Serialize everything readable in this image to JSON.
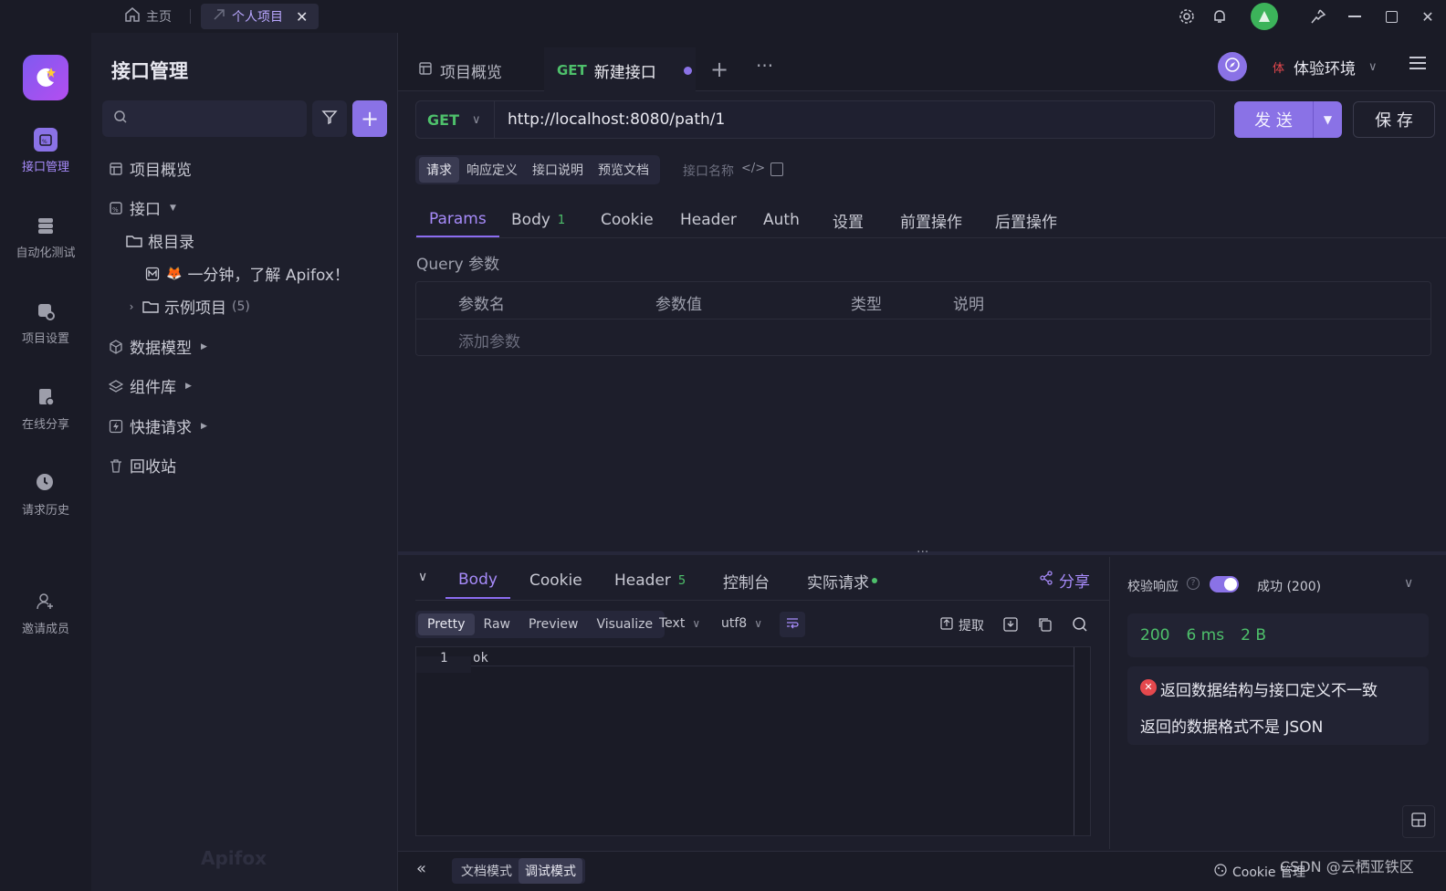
{
  "titlebar": {
    "home_tab": "主页",
    "project_tab": "个人项目"
  },
  "rail": {
    "items": [
      {
        "label": "接口管理"
      },
      {
        "label": "自动化测试"
      },
      {
        "label": "项目设置"
      },
      {
        "label": "在线分享"
      },
      {
        "label": "请求历史"
      },
      {
        "label": "邀请成员"
      }
    ]
  },
  "tree": {
    "title": "接口管理",
    "search_placeholder": "",
    "overview": "项目概览",
    "api": "接口",
    "root": "根目录",
    "intro_doc": "一分钟，了解 Apifox！",
    "example": "示例项目",
    "example_count": "(5)",
    "data_model": "数据模型",
    "components": "组件库",
    "quick_request": "快捷请求",
    "recycle": "回收站",
    "watermark": "Apifox"
  },
  "main": {
    "tabs": [
      {
        "label": "项目概览"
      },
      {
        "method": "GET",
        "label": "新建接口"
      }
    ],
    "env_badge": "体",
    "env": "体验环境",
    "method": "GET",
    "url": "http://localhost:8080/path/1",
    "send": "发 送",
    "save": "保 存",
    "mode_tabs": [
      "请求",
      "响应定义",
      "接口说明",
      "预览文档"
    ],
    "api_name_placeholder": "接口名称",
    "req_tabs": [
      {
        "label": "Params"
      },
      {
        "label": "Body",
        "count": "1"
      },
      {
        "label": "Cookie"
      },
      {
        "label": "Header"
      },
      {
        "label": "Auth"
      },
      {
        "label": "设置"
      },
      {
        "label": "前置操作"
      },
      {
        "label": "后置操作"
      }
    ],
    "query_title": "Query 参数",
    "columns": [
      "参数名",
      "参数值",
      "类型",
      "说明"
    ],
    "add_param": "添加参数"
  },
  "response": {
    "tabs": [
      {
        "label": "Body"
      },
      {
        "label": "Cookie"
      },
      {
        "label": "Header",
        "count": "5"
      },
      {
        "label": "控制台"
      },
      {
        "label": "实际请求"
      }
    ],
    "share": "分享",
    "format_tabs": [
      "Pretty",
      "Raw",
      "Preview",
      "Visualize"
    ],
    "type": "Text",
    "encoding": "utf8",
    "extract": "提取",
    "line_no": "1",
    "body": "ok",
    "validate_label": "校验响应",
    "validate_result": "成功 (200)",
    "status": "200",
    "time": "6 ms",
    "size": "2 B",
    "error_title": "返回数据结构与接口定义不一致",
    "error_detail": "返回的数据格式不是 JSON"
  },
  "footer": {
    "doc_mode": "文档模式",
    "debug_mode": "调试模式",
    "cookie_manage": "Cookie 管理",
    "watermark": "CSDN @云栖亚铁区"
  },
  "colors": {
    "accent": "#8a72e6",
    "success": "#4ec06b",
    "error": "#e5484d",
    "bg": "#1d1e2b"
  }
}
